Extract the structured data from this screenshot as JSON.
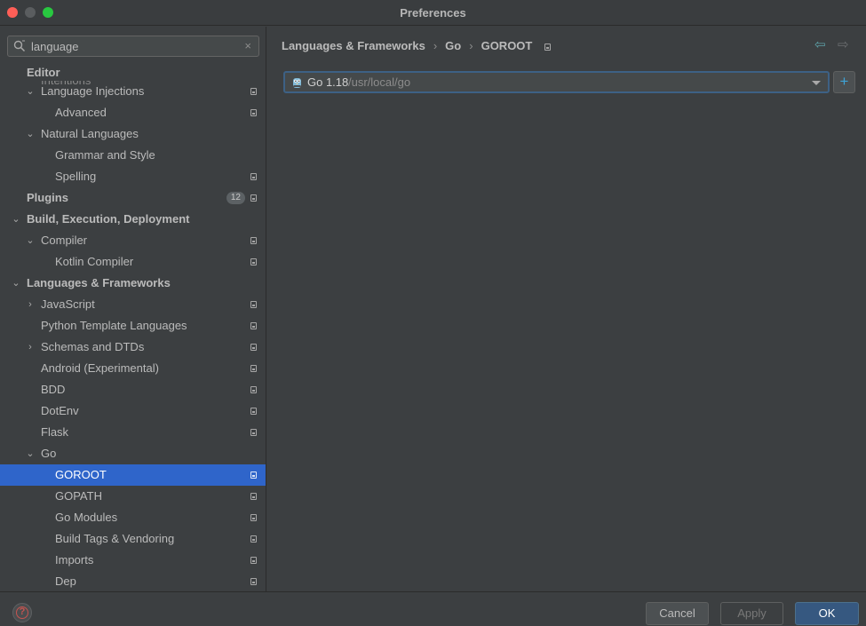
{
  "window": {
    "title": "Preferences"
  },
  "search": {
    "value": "language",
    "clear_icon": "×"
  },
  "sidebar": {
    "sticky_header": "Editor",
    "ghost_item": "Intentions",
    "items": [
      {
        "label": "Language Injections",
        "level": 1,
        "arrow": "⌄",
        "proj": true
      },
      {
        "label": "Advanced",
        "level": 2,
        "arrow": "",
        "proj": true
      },
      {
        "label": "Natural Languages",
        "level": 1,
        "arrow": "⌄",
        "proj": false
      },
      {
        "label": "Grammar and Style",
        "level": 2,
        "arrow": "",
        "proj": false
      },
      {
        "label": "Spelling",
        "level": 2,
        "arrow": "",
        "proj": true
      },
      {
        "label": "Plugins",
        "level": 0,
        "arrow": "",
        "proj": true,
        "bold": true,
        "badge": "12"
      },
      {
        "label": "Build, Execution, Deployment",
        "level": 0,
        "arrow": "⌄",
        "proj": false,
        "bold": true
      },
      {
        "label": "Compiler",
        "level": 1,
        "arrow": "⌄",
        "proj": true
      },
      {
        "label": "Kotlin Compiler",
        "level": 2,
        "arrow": "",
        "proj": true
      },
      {
        "label": "Languages & Frameworks",
        "level": 0,
        "arrow": "⌄",
        "proj": false,
        "bold": true
      },
      {
        "label": "JavaScript",
        "level": 1,
        "arrow": "›",
        "proj": true
      },
      {
        "label": "Python Template Languages",
        "level": 1,
        "arrow": "",
        "proj": true
      },
      {
        "label": "Schemas and DTDs",
        "level": 1,
        "arrow": "›",
        "proj": true
      },
      {
        "label": "Android (Experimental)",
        "level": 1,
        "arrow": "",
        "proj": true
      },
      {
        "label": "BDD",
        "level": 1,
        "arrow": "",
        "proj": true
      },
      {
        "label": "DotEnv",
        "level": 1,
        "arrow": "",
        "proj": true
      },
      {
        "label": "Flask",
        "level": 1,
        "arrow": "",
        "proj": true
      },
      {
        "label": "Go",
        "level": 1,
        "arrow": "⌄",
        "proj": false
      },
      {
        "label": "GOROOT",
        "level": 2,
        "arrow": "",
        "proj": true,
        "selected": true
      },
      {
        "label": "GOPATH",
        "level": 2,
        "arrow": "",
        "proj": true
      },
      {
        "label": "Go Modules",
        "level": 2,
        "arrow": "",
        "proj": true
      },
      {
        "label": "Build Tags & Vendoring",
        "level": 2,
        "arrow": "",
        "proj": true
      },
      {
        "label": "Imports",
        "level": 2,
        "arrow": "",
        "proj": true
      },
      {
        "label": "Dep",
        "level": 2,
        "arrow": "",
        "proj": true
      }
    ]
  },
  "main": {
    "breadcrumb": [
      "Languages & Frameworks",
      "Go",
      "GOROOT"
    ],
    "breadcrumb_separator": "›",
    "nav_back": "⇦",
    "nav_forward": "⇨",
    "sdk": {
      "name": "Go 1.18",
      "path": "/usr/local/go"
    },
    "add_label": "+"
  },
  "footer": {
    "help_label": "?",
    "cancel_label": "Cancel",
    "apply_label": "Apply",
    "ok_label": "OK"
  },
  "colors": {
    "selected_row": "#2f65ca",
    "ok_button": "#365880",
    "window_bg": "#3c3f41",
    "close_dot": "#ff5f57",
    "max_dot": "#28c840"
  }
}
